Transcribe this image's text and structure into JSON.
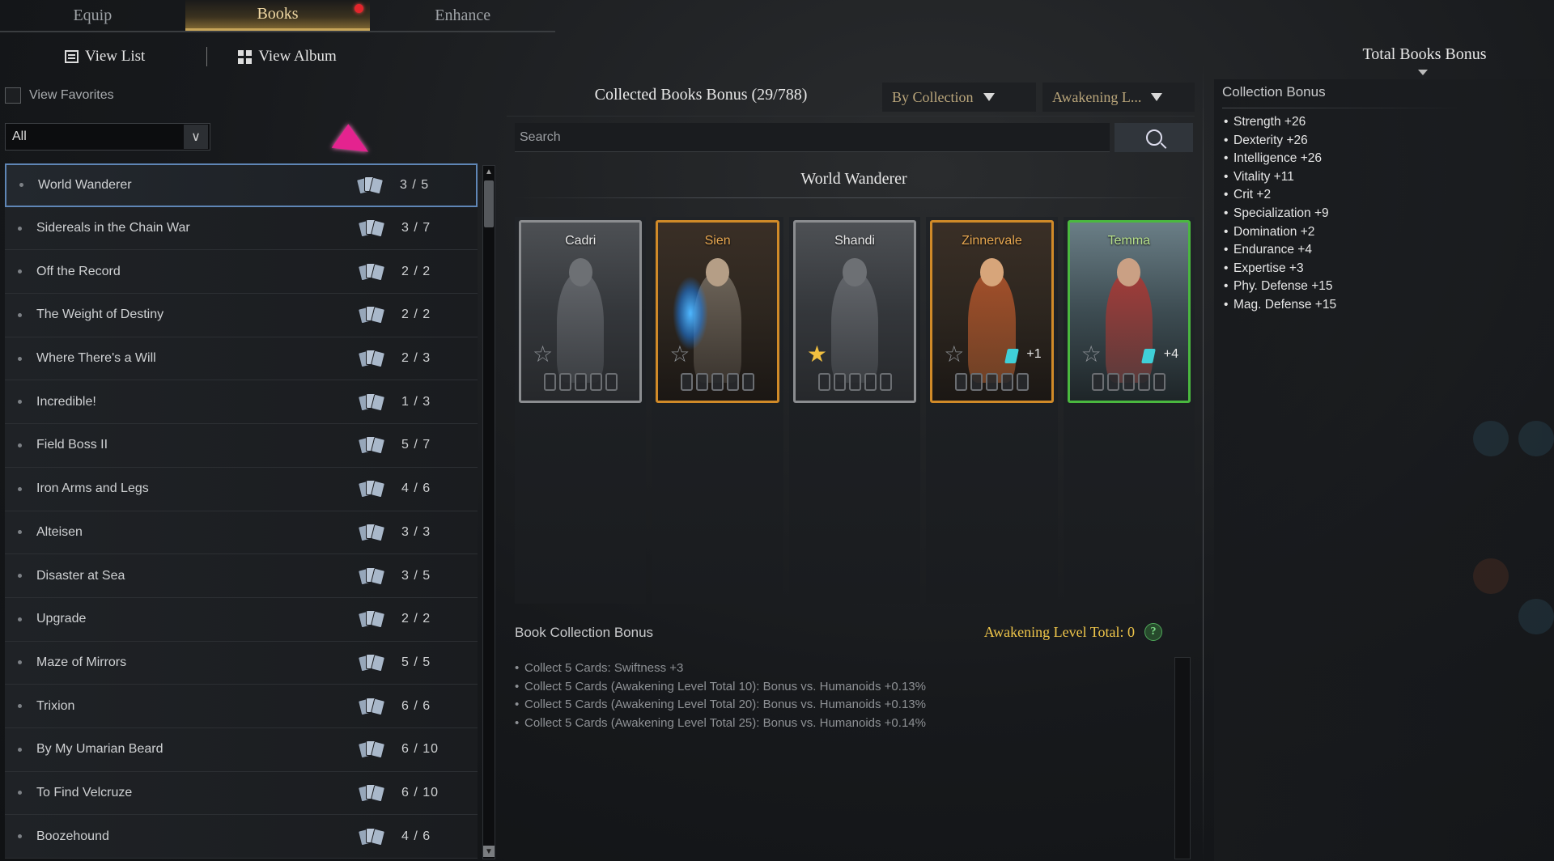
{
  "tabs": [
    {
      "label": "Equip",
      "active": false
    },
    {
      "label": "Books",
      "active": true,
      "notification": true
    },
    {
      "label": "Enhance",
      "active": false
    }
  ],
  "view_toggle": {
    "list_label": "View List",
    "album_label": "View Album"
  },
  "left": {
    "view_favorites_label": "View Favorites",
    "filter_value": "All",
    "items": [
      {
        "name": "World Wanderer",
        "count": "3 / 5",
        "selected": true
      },
      {
        "name": "Sidereals in the Chain War",
        "count": "3 / 7"
      },
      {
        "name": "Off the Record",
        "count": "2 / 2"
      },
      {
        "name": "The Weight of Destiny",
        "count": "2 / 2"
      },
      {
        "name": "Where There's a Will",
        "count": "2 / 3"
      },
      {
        "name": "Incredible!",
        "count": "1 / 3"
      },
      {
        "name": "Field Boss II",
        "count": "5 / 7"
      },
      {
        "name": "Iron Arms and Legs",
        "count": "4 / 6"
      },
      {
        "name": "Alteisen",
        "count": "3 / 3"
      },
      {
        "name": "Disaster at Sea",
        "count": "3 / 5"
      },
      {
        "name": "Upgrade",
        "count": "2 / 2"
      },
      {
        "name": "Maze of Mirrors",
        "count": "5 / 5"
      },
      {
        "name": "Trixion",
        "count": "6 / 6"
      },
      {
        "name": "By My Umarian Beard",
        "count": "6 / 10"
      },
      {
        "name": "To Find Velcruze",
        "count": "6 / 10"
      },
      {
        "name": "Boozehound",
        "count": "4 / 6"
      }
    ]
  },
  "center": {
    "collected_title": "Collected Books Bonus (29/788)",
    "sort_collection_label": "By Collection",
    "sort_awakening_label": "Awakening L...",
    "search_placeholder": "Search",
    "collection_name": "World Wanderer",
    "cards": [
      {
        "name": "Cadri",
        "rarity": "grey",
        "star": "☆",
        "plus": ""
      },
      {
        "name": "Sien",
        "rarity": "orange",
        "star": "☆",
        "plus": ""
      },
      {
        "name": "Shandi",
        "rarity": "grey",
        "star": "★",
        "plus": ""
      },
      {
        "name": "Zinnervale",
        "rarity": "orange",
        "star": "☆",
        "plus": "+1"
      },
      {
        "name": "Temma",
        "rarity": "green",
        "star": "☆",
        "plus": "+4"
      }
    ],
    "book_collection_bonus_title": "Book Collection Bonus",
    "awakening_total_label": "Awakening Level Total: 0",
    "help_symbol": "?",
    "bonus_lines": [
      "Collect 5 Cards: Swiftness +3",
      "Collect 5 Cards (Awakening Level Total 10): Bonus vs. Humanoids +0.13%",
      "Collect 5 Cards (Awakening Level Total 20): Bonus vs. Humanoids +0.13%",
      "Collect 5 Cards (Awakening Level Total 25): Bonus vs. Humanoids +0.14%"
    ]
  },
  "right": {
    "title": "Total Books Bonus",
    "collection_bonus_title": "Collection Bonus",
    "stats": [
      "Strength +26",
      "Dexterity +26",
      "Intelligence +26",
      "Vitality +11",
      "Crit +2",
      "Specialization +9",
      "Domination +2",
      "Endurance +4",
      "Expertise +3",
      "Phy. Defense +15",
      "Mag. Defense +15"
    ]
  },
  "colors": {
    "accent_gold": "#f0c64a",
    "selected_border": "#5f86b6",
    "card_grey": "#8b8d90",
    "card_orange": "#d08a28",
    "card_green": "#4ab83f",
    "notification_red": "#e2252b"
  },
  "icons": [
    "list-icon",
    "grid-icon",
    "cards-icon",
    "search-icon",
    "star-icon",
    "help-icon",
    "dropdown-arrow-icon",
    "scroll-arrow-icon"
  ]
}
